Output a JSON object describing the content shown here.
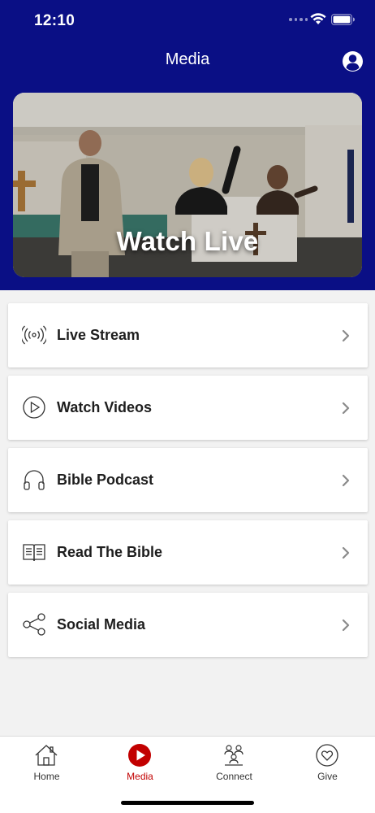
{
  "status_bar": {
    "time": "12:10"
  },
  "header": {
    "title": "Media",
    "profile_icon": "person-circle-icon"
  },
  "hero": {
    "label": "Watch Live"
  },
  "menu": [
    {
      "label": "Live Stream",
      "icon": "broadcast-icon"
    },
    {
      "label": "Watch Videos",
      "icon": "play-circle-icon"
    },
    {
      "label": "Bible Podcast",
      "icon": "headphones-icon"
    },
    {
      "label": "Read The Bible",
      "icon": "open-book-icon"
    },
    {
      "label": "Social Media",
      "icon": "share-icon"
    }
  ],
  "tabs": [
    {
      "label": "Home",
      "icon": "house-icon",
      "active": false
    },
    {
      "label": "Media",
      "icon": "play-circle-filled-icon",
      "active": true
    },
    {
      "label": "Connect",
      "icon": "people-icon",
      "active": false
    },
    {
      "label": "Give",
      "icon": "heart-circle-icon",
      "active": false
    }
  ],
  "colors": {
    "header_bg": "#0a0f85",
    "active_tab": "#c20000",
    "page_bg": "#f2f2f2"
  }
}
